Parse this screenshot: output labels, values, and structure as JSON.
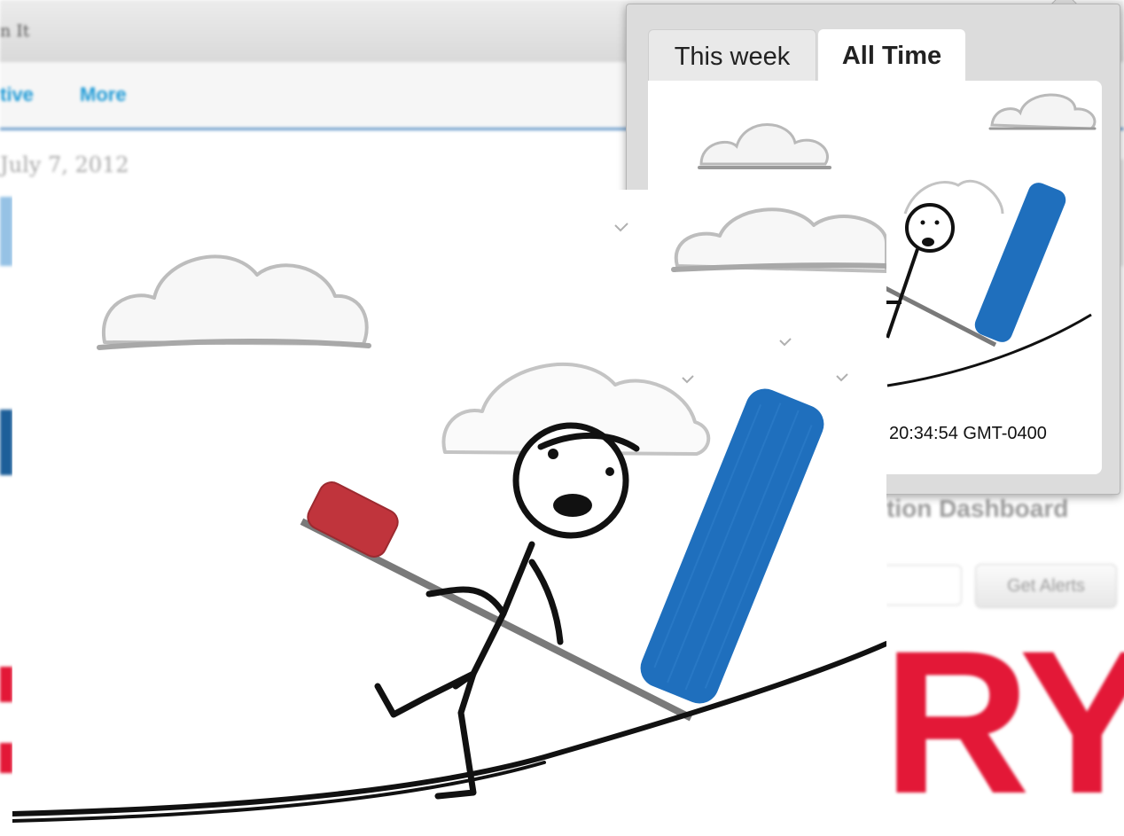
{
  "background_page": {
    "window_title": "n It",
    "nav_links": [
      "tive",
      "More"
    ],
    "date": "July 7, 2012",
    "side_heading": "tion Dashboard",
    "alerts_button": "Get Alerts",
    "big_word": "RY"
  },
  "popover": {
    "tabs": [
      {
        "label": "This week",
        "selected": false
      },
      {
        "label": "All Time",
        "selected": true
      }
    ],
    "timestamp": "20:34:54 GMT-0400"
  },
  "illustration": {
    "description_icon": "stick-figure-seesaw-illustration",
    "colors": {
      "blue_block": "#1f6fbd",
      "red_block": "#c0343c",
      "seesaw": "#7a7a7a",
      "ink": "#111111",
      "cloud": "#bdbdbd"
    }
  },
  "colors": {
    "link": "#1e9ad6",
    "brand_red": "#e31837",
    "nav_rule": "#6a9ccc"
  }
}
